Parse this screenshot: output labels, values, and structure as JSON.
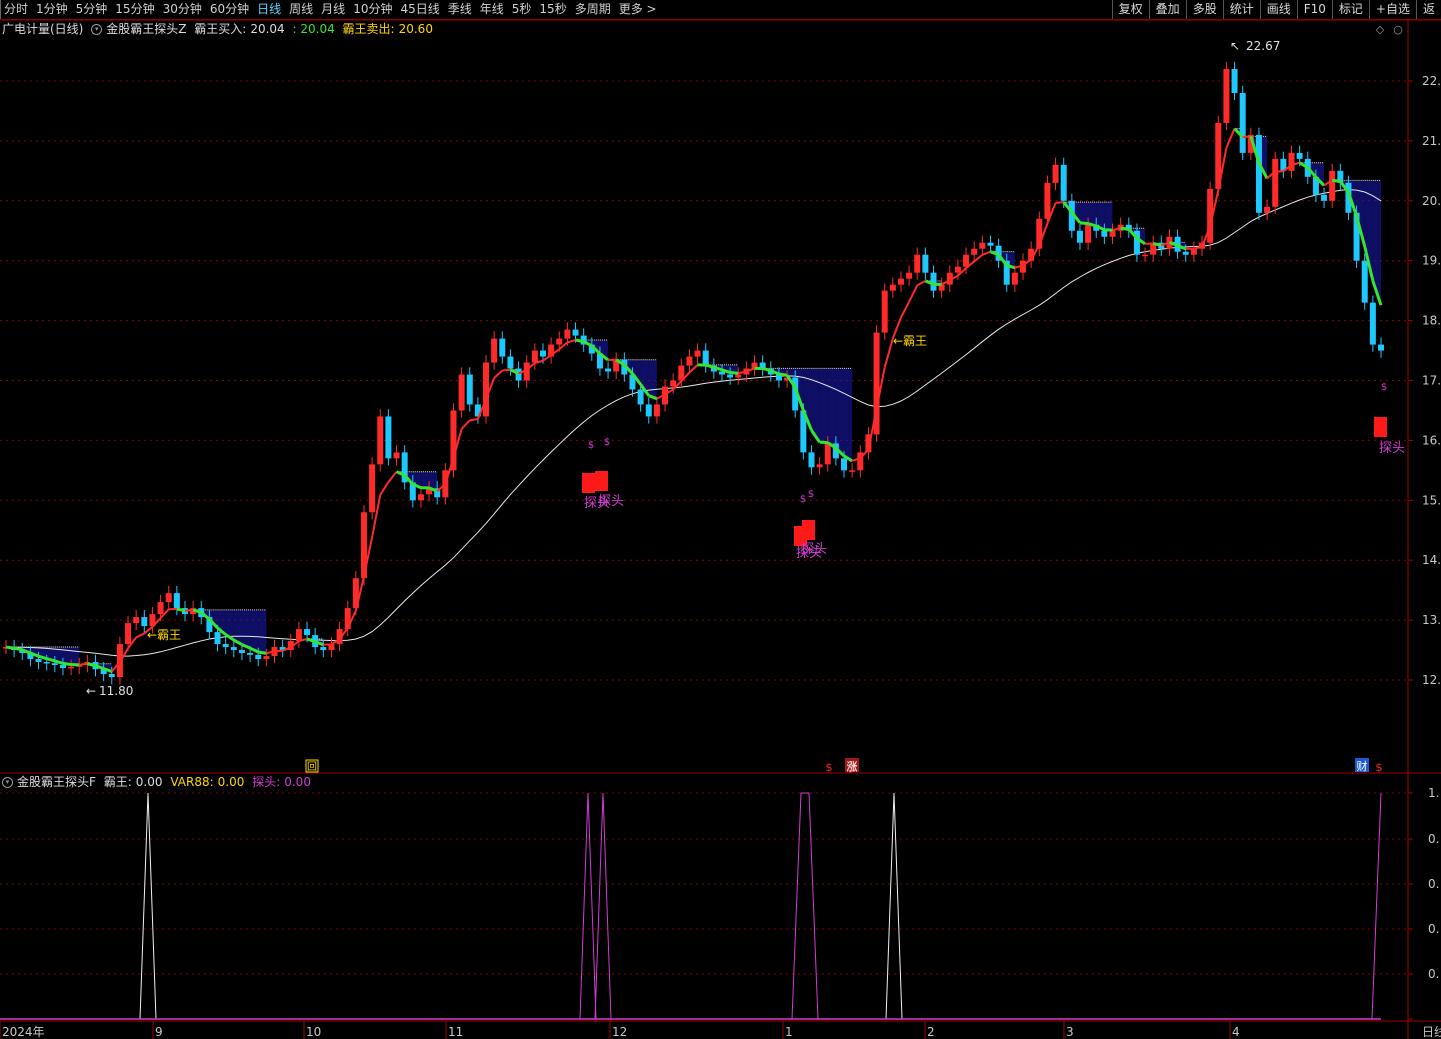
{
  "toolbar": {
    "tabs": [
      {
        "label": "分时",
        "active": false
      },
      {
        "label": "1分钟",
        "active": false
      },
      {
        "label": "5分钟",
        "active": false
      },
      {
        "label": "15分钟",
        "active": false
      },
      {
        "label": "30分钟",
        "active": false
      },
      {
        "label": "60分钟",
        "active": false
      },
      {
        "label": "日线",
        "active": true
      },
      {
        "label": "周线",
        "active": false
      },
      {
        "label": "月线",
        "active": false
      },
      {
        "label": "10分钟",
        "active": false
      },
      {
        "label": "45日线",
        "active": false
      },
      {
        "label": "季线",
        "active": false
      },
      {
        "label": "年线",
        "active": false
      },
      {
        "label": "5秒",
        "active": false
      },
      {
        "label": "15秒",
        "active": false
      },
      {
        "label": "多周期",
        "active": false
      },
      {
        "label": "更多 >",
        "active": false
      }
    ],
    "right_buttons": [
      "复权",
      "叠加",
      "多股",
      "统计",
      "画线",
      "F10",
      "标记",
      "+自选",
      "返"
    ]
  },
  "main_legend": {
    "title": "广电计量(日线)",
    "indicator": "金股霸王探头Z",
    "buy_label": "霸王买入:",
    "buy_value": "20.04",
    "sep_value": ": 20.04",
    "sell_label": "霸王卖出:",
    "sell_value": "20.60"
  },
  "sub_legend": {
    "indicator": "金股霸王探头F",
    "bawang_label": "霸王:",
    "bawang_value": "0.00",
    "var_label": "VAR88:",
    "var_value": "0.00",
    "tantou_label": "探头:",
    "tantou_value": "0.00"
  },
  "annotations": {
    "high_label": "22.67",
    "low_label": "11.80",
    "bawang_arrow": "←霸王",
    "tantou": "探头",
    "dollar": "$",
    "event_hui": "回",
    "event_zhang": "涨",
    "event_cai": "财"
  },
  "colors": {
    "up": "#ff2b2b",
    "down": "#1ec8ff",
    "buy_line": "#ff2b2b",
    "sell_line": "#32e632",
    "slow_line": "#e8e8e8",
    "band_fill": "#1a1ab8",
    "band_top": "#e6e6a0",
    "yellow": "#ffd700",
    "magenta": "#d23cd2",
    "grid": "#8a0000",
    "axis": "#a00000"
  },
  "chart_data": {
    "type": "candlestick",
    "price_axis": {
      "ticks": [
        "22.",
        "21.",
        "20.",
        "19.",
        "18.",
        "17.",
        "16.",
        "15.",
        "14.",
        "13.",
        "12."
      ],
      "range": [
        11.0,
        23.0
      ]
    },
    "indicator_axis": {
      "ticks": [
        "1.",
        "0.",
        "0.",
        "0.",
        "0.",
        "0."
      ],
      "range": [
        0,
        1
      ]
    },
    "x_axis_labels": [
      "2024年",
      "9",
      "10",
      "11",
      "12",
      "1",
      "2",
      "3",
      "4"
    ],
    "bottom_right_label": "日线",
    "closes": [
      12.55,
      12.5,
      12.45,
      12.35,
      12.3,
      12.28,
      12.25,
      12.2,
      12.22,
      12.25,
      12.3,
      12.18,
      12.1,
      12.05,
      12.6,
      12.95,
      13.05,
      12.9,
      13.1,
      13.3,
      13.45,
      13.2,
      13.1,
      13.2,
      13.05,
      12.8,
      12.6,
      12.55,
      12.5,
      12.45,
      12.42,
      12.35,
      12.4,
      12.55,
      12.5,
      12.65,
      12.85,
      12.75,
      12.55,
      12.5,
      12.6,
      12.85,
      13.2,
      13.7,
      14.8,
      15.6,
      16.4,
      15.7,
      15.8,
      15.3,
      15.0,
      15.1,
      15.2,
      15.05,
      15.5,
      16.5,
      17.1,
      16.6,
      16.4,
      17.3,
      17.7,
      17.4,
      17.2,
      17.0,
      17.3,
      17.5,
      17.4,
      17.6,
      17.7,
      17.85,
      17.75,
      17.6,
      17.45,
      17.2,
      17.15,
      17.35,
      17.1,
      16.85,
      16.6,
      16.4,
      16.6,
      16.9,
      17.0,
      17.25,
      17.4,
      17.5,
      17.25,
      17.15,
      17.1,
      17.05,
      17.1,
      17.2,
      17.3,
      17.2,
      17.1,
      17.0,
      17.05,
      16.5,
      15.8,
      15.55,
      15.6,
      15.95,
      15.7,
      15.5,
      15.5,
      15.8,
      16.1,
      17.8,
      18.5,
      18.6,
      18.7,
      18.8,
      19.1,
      18.8,
      18.5,
      18.6,
      18.8,
      18.9,
      19.1,
      19.2,
      19.3,
      19.25,
      19.0,
      18.6,
      18.8,
      19.0,
      19.2,
      19.7,
      20.3,
      20.6,
      20.0,
      19.5,
      19.3,
      19.6,
      19.5,
      19.4,
      19.5,
      19.6,
      19.5,
      19.1,
      19.1,
      19.3,
      19.2,
      19.4,
      19.15,
      19.1,
      19.2,
      19.3,
      20.2,
      21.3,
      22.2,
      21.8,
      20.8,
      21.1,
      19.8,
      19.9,
      20.7,
      20.5,
      20.8,
      20.7,
      20.4,
      20.1,
      20.0,
      20.5,
      20.3,
      19.8,
      19.0,
      18.3,
      17.6,
      17.5
    ],
    "buy_line_color": "red/green rising-falling",
    "tantou_signals": [
      "2024-12",
      "2024-12",
      "2025-01",
      "2025-04"
    ]
  }
}
